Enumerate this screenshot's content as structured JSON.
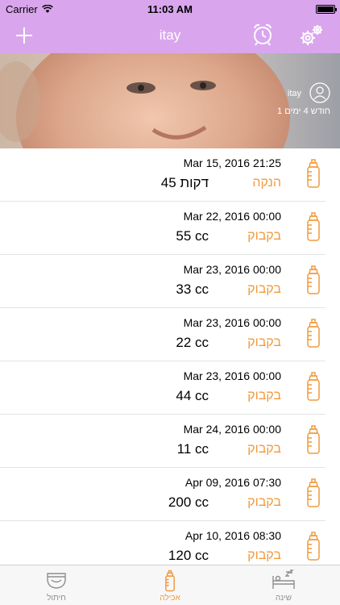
{
  "status_bar": {
    "carrier": "Carrier",
    "time": "11:03 AM"
  },
  "nav": {
    "title": "itay",
    "add_icon": "plus-icon",
    "alarm_icon": "alarm-clock-icon",
    "settings_icon": "gear-icon"
  },
  "profile": {
    "name": "itay",
    "age": "1 חודש 4 ימים"
  },
  "entries": [
    {
      "date": "Mar 15, 2016 21:25",
      "type": "הנקה",
      "amount": "45 דקות"
    },
    {
      "date": "Mar 22, 2016 00:00",
      "type": "בקבוק",
      "amount": "55 cc"
    },
    {
      "date": "Mar 23, 2016 00:00",
      "type": "בקבוק",
      "amount": "33 cc"
    },
    {
      "date": "Mar 23, 2016 00:00",
      "type": "בקבוק",
      "amount": "22 cc"
    },
    {
      "date": "Mar 23, 2016 00:00",
      "type": "בקבוק",
      "amount": "44 cc"
    },
    {
      "date": "Mar 24, 2016 00:00",
      "type": "בקבוק",
      "amount": "11 cc"
    },
    {
      "date": "Apr 09, 2016 07:30",
      "type": "בקבוק",
      "amount": "200 cc"
    },
    {
      "date": "Apr 10, 2016 08:30",
      "type": "בקבוק",
      "amount": "120 cc"
    }
  ],
  "tabs": [
    {
      "label": "חיתול",
      "icon": "diaper-icon"
    },
    {
      "label": "אכילה",
      "icon": "bottle-icon",
      "active": true
    },
    {
      "label": "שינה",
      "icon": "bed-icon"
    }
  ],
  "colors": {
    "accent": "#d9a6ee",
    "type_text": "#f29a3c"
  }
}
